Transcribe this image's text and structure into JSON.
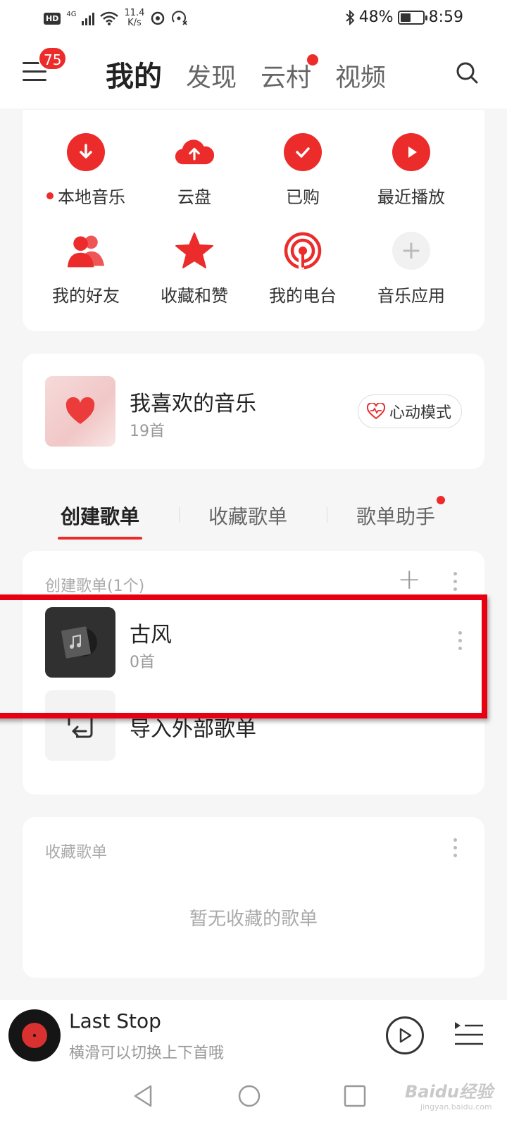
{
  "status_bar": {
    "hd": "HD",
    "network": "4G",
    "speed_value": "11.4",
    "speed_unit": "K/s",
    "battery": "48%",
    "battery_level": 0.48,
    "time": "8:59"
  },
  "top_nav": {
    "menu_badge": "75",
    "tabs": [
      "我的",
      "发现",
      "云村",
      "视频"
    ],
    "active_tab": "我的"
  },
  "shortcuts": [
    {
      "label": "本地音乐",
      "icon": "download-icon"
    },
    {
      "label": "云盘",
      "icon": "cloud-upload-icon"
    },
    {
      "label": "已购",
      "icon": "check-icon"
    },
    {
      "label": "最近播放",
      "icon": "play-icon"
    },
    {
      "label": "我的好友",
      "icon": "friends-icon"
    },
    {
      "label": "收藏和赞",
      "icon": "star-icon"
    },
    {
      "label": "我的电台",
      "icon": "radio-icon"
    },
    {
      "label": "音乐应用",
      "icon": "plus-icon"
    }
  ],
  "liked": {
    "title": "我喜欢的音乐",
    "count": "19首",
    "mode_button": "心动模式"
  },
  "playlist_tabs": [
    "创建歌单",
    "收藏歌单",
    "歌单助手"
  ],
  "created": {
    "header": "创建歌单(1个)",
    "playlists": [
      {
        "title": "古风",
        "count": "0首"
      }
    ],
    "import_label": "导入外部歌单"
  },
  "collected": {
    "header": "收藏歌单",
    "empty_text": "暂无收藏的歌单"
  },
  "player": {
    "title": "Last Stop",
    "subtitle": "横滑可以切换上下首哦"
  },
  "watermark": {
    "brand": "Baidu经验",
    "url": "jingyan.baidu.com"
  },
  "colors": {
    "accent": "#ec2b2b",
    "highlight": "#e60012"
  }
}
